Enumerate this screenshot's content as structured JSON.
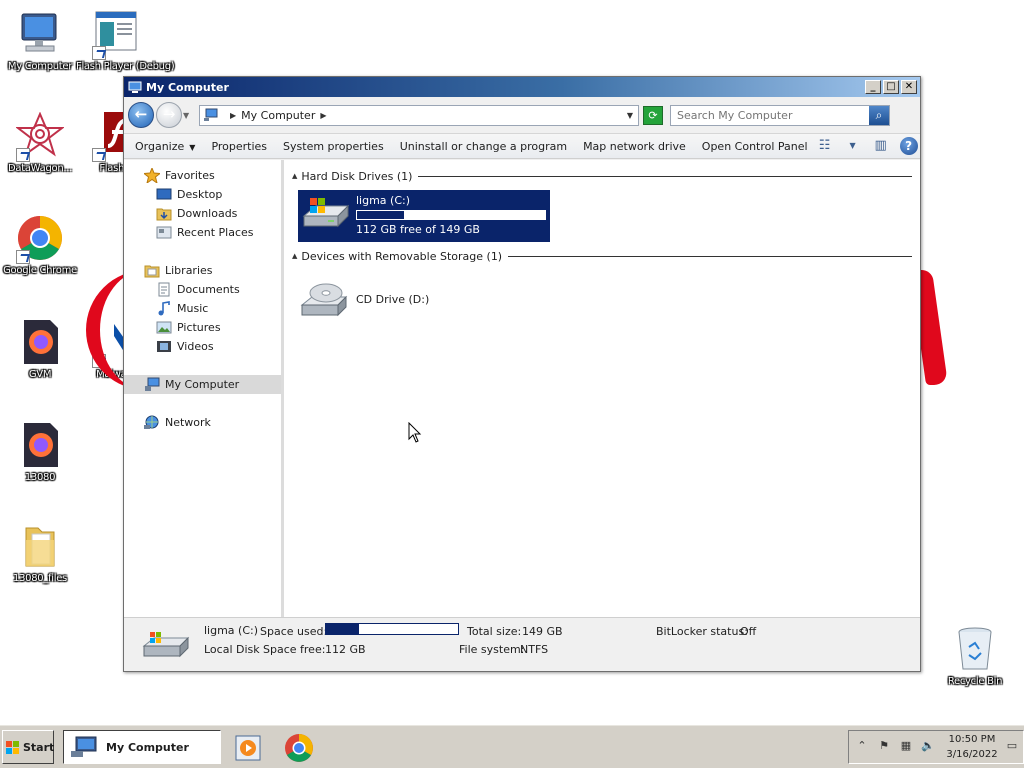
{
  "desktop": {
    "icons": [
      {
        "label": "My Computer"
      },
      {
        "label": "Flash Player (Debug)"
      },
      {
        "label": "DataWagon..."
      },
      {
        "label": "Flash P"
      },
      {
        "label": "Google Chrome"
      },
      {
        "label": "GVM"
      },
      {
        "label": "Malware"
      },
      {
        "label": "13080"
      },
      {
        "label": "13080_files"
      },
      {
        "label": "Recycle Bin"
      }
    ]
  },
  "window": {
    "title": "My Computer",
    "caption": {
      "minimize": "_",
      "maximize": "□",
      "close": "✕"
    },
    "address": {
      "location": "My Computer"
    },
    "search": {
      "placeholder": "Search My Computer"
    },
    "toolbar": {
      "organize": "Organize",
      "properties": "Properties",
      "system_properties": "System properties",
      "uninstall": "Uninstall or change a program",
      "map_drive": "Map network drive",
      "control_panel": "Open Control Panel"
    },
    "nav": {
      "favorites": "Favorites",
      "desktop": "Desktop",
      "downloads": "Downloads",
      "recent": "Recent Places",
      "libraries": "Libraries",
      "documents": "Documents",
      "music": "Music",
      "pictures": "Pictures",
      "videos": "Videos",
      "my_computer": "My Computer",
      "network": "Network"
    },
    "groups": {
      "hard_disk": "Hard Disk Drives (1)",
      "removable": "Devices with Removable Storage (1)"
    },
    "drive_c": {
      "name": "ligma (C:)",
      "free_text": "112 GB free of 149 GB",
      "used_fraction": 0.25
    },
    "drive_d": {
      "name": "CD Drive (D:)"
    },
    "details": {
      "name": "ligma (C:)",
      "type": "Local Disk",
      "space_used_label": "Space used:",
      "space_free_label": "Space free:",
      "space_free_value": "112 GB",
      "total_size_label": "Total size:",
      "total_size_value": "149 GB",
      "file_system_label": "File system:",
      "file_system_value": "NTFS",
      "bitlocker_label": "BitLocker status:",
      "bitlocker_value": "Off",
      "used_fraction": 0.25
    }
  },
  "taskbar": {
    "start": "Start",
    "active_task": "My Computer",
    "clock": {
      "time": "10:50 PM",
      "date": "3/16/2022"
    }
  },
  "colors": {
    "accent": "#0a246a",
    "desktop": "#ffffff",
    "taskbar": "#d4d0c8",
    "malware_red": "#e0081c"
  },
  "icons": [
    "my-computer-icon",
    "flash-icon",
    "datawagon-icon",
    "chrome-icon",
    "firefox-icon",
    "folder-icon",
    "recycle-bin-icon",
    "hard-drive-icon",
    "cd-drive-icon",
    "star-icon",
    "network-icon",
    "search-icon",
    "help-icon"
  ]
}
